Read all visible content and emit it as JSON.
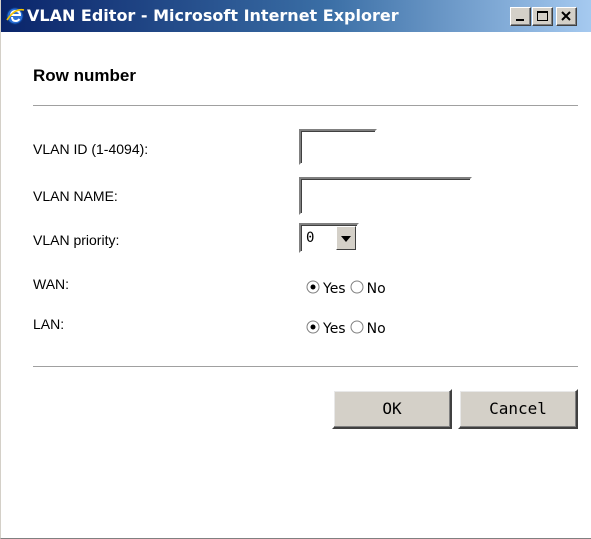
{
  "window": {
    "title": "VLAN Editor - Microsoft Internet Explorer",
    "controls": {
      "minimize": "minimize-icon",
      "maximize": "maximize-icon",
      "close": "close-icon"
    }
  },
  "form": {
    "heading": "Row number",
    "vlan_id": {
      "label": "VLAN ID (1-4094):",
      "value": ""
    },
    "vlan_name": {
      "label": "VLAN NAME:",
      "value": ""
    },
    "vlan_priority": {
      "label": "VLAN priority:",
      "selected": "0"
    },
    "wan": {
      "label": "WAN:",
      "yes": "Yes",
      "no": "No",
      "selected": "Yes"
    },
    "lan": {
      "label": "LAN:",
      "yes": "Yes",
      "no": "No",
      "selected": "Yes"
    }
  },
  "buttons": {
    "ok": "OK",
    "cancel": "Cancel"
  }
}
